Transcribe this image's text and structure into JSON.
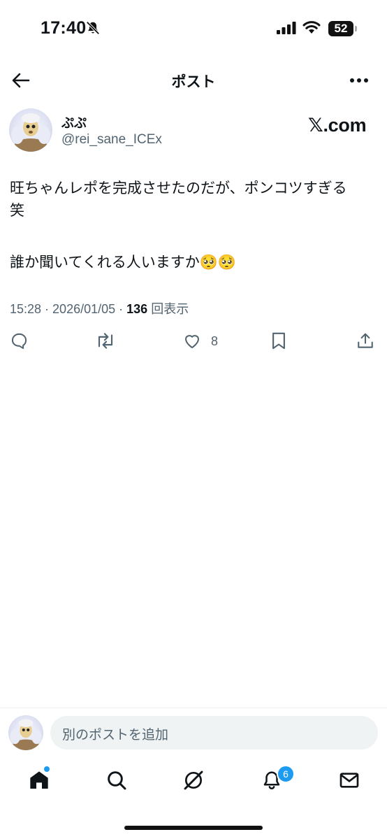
{
  "status_bar": {
    "time": "17:40",
    "battery": "52"
  },
  "header": {
    "title": "ポスト"
  },
  "post": {
    "author_name": "ぷぷ",
    "author_handle": "@rei_sane_ICEx",
    "brand": "𝕏.com",
    "lines": [
      "旺ちゃんレポを完成させたのだが、ポンコツすぎる",
      "笑",
      "誰か聞いてくれる人いますか🥺🥺"
    ],
    "time": "15:28",
    "date": "2026/01/05",
    "views_count": "136",
    "views_label": "回表示",
    "like_count": "8"
  },
  "reply": {
    "placeholder": "別のポストを追加"
  },
  "tabbar": {
    "notification_badge": "6"
  },
  "colors": {
    "accent": "#1d9bf0",
    "text": "#0f1419",
    "muted": "#536471"
  }
}
